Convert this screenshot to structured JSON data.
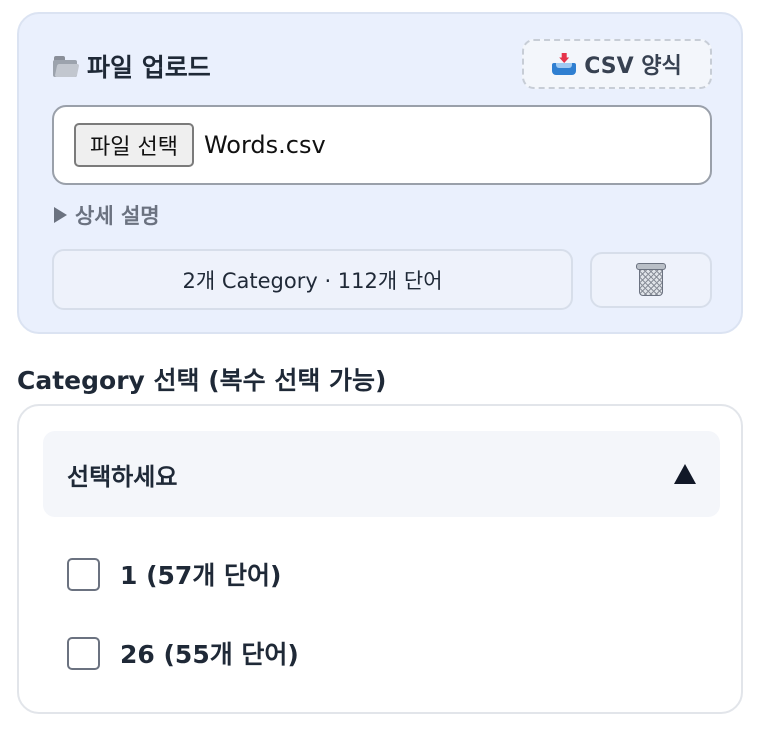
{
  "upload": {
    "title": "파일 업로드",
    "csv_button_label": "CSV 양식",
    "file_pick_label": "파일 선택",
    "file_name": "Words.csv",
    "details_label": "상세 설명",
    "summary": "2개 Category · 112개 단어"
  },
  "category": {
    "label": "Category 선택 (복수 선택 가능)",
    "placeholder": "선택하세요",
    "options": [
      {
        "label": "1 (57개 단어)",
        "checked": false
      },
      {
        "label": "26 (55개 단어)",
        "checked": false
      }
    ]
  },
  "icons": {
    "title": "folder-icon",
    "csv": "inbox-tray-icon",
    "delete": "wastebasket-icon",
    "details": "triangle-right-icon",
    "dropdown": "triangle-up-icon"
  },
  "colors": {
    "upload_card_bg": "#eaf0fd",
    "text": "#1f2937",
    "muted": "#6b7280"
  }
}
